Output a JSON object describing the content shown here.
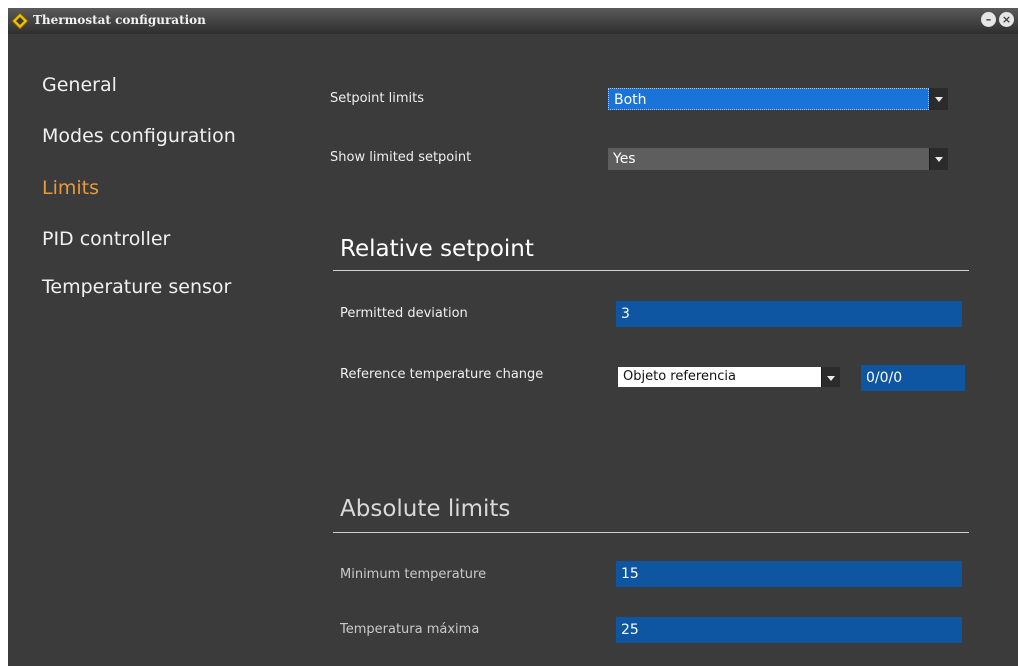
{
  "window": {
    "title": "Thermostat configuration",
    "icon": "thermostat-app-icon",
    "minimize_label": "–",
    "close_label": "×"
  },
  "sidebar": {
    "items": [
      {
        "label": "General",
        "active": false
      },
      {
        "label": "Modes configuration",
        "active": false
      },
      {
        "label": "Limits",
        "active": true
      },
      {
        "label": "PID controller",
        "active": false
      },
      {
        "label": "Temperature sensor",
        "active": false
      }
    ]
  },
  "settings": {
    "setpoint_limits": {
      "label": "Setpoint limits",
      "value": "Both"
    },
    "show_limited_setpoint": {
      "label": "Show limited setpoint",
      "value": "Yes"
    }
  },
  "relative_setpoint": {
    "title": "Relative setpoint",
    "permitted_deviation": {
      "label": "Permitted deviation",
      "value": "3"
    },
    "reference_temperature_change": {
      "label": "Reference temperature change",
      "select_value": "Objeto referencia",
      "address": "0/0/0"
    }
  },
  "absolute_limits": {
    "title": "Absolute limits",
    "minimum_temperature": {
      "label": "Minimum temperature",
      "value": "15"
    },
    "maximum_temperature": {
      "label": "Temperatura máxima",
      "value": "25"
    }
  },
  "colors": {
    "background": "#3b3b3b",
    "active_nav": "#e99a3a",
    "field_blue": "#0e56a2",
    "select_gray": "#5e5e5e"
  }
}
